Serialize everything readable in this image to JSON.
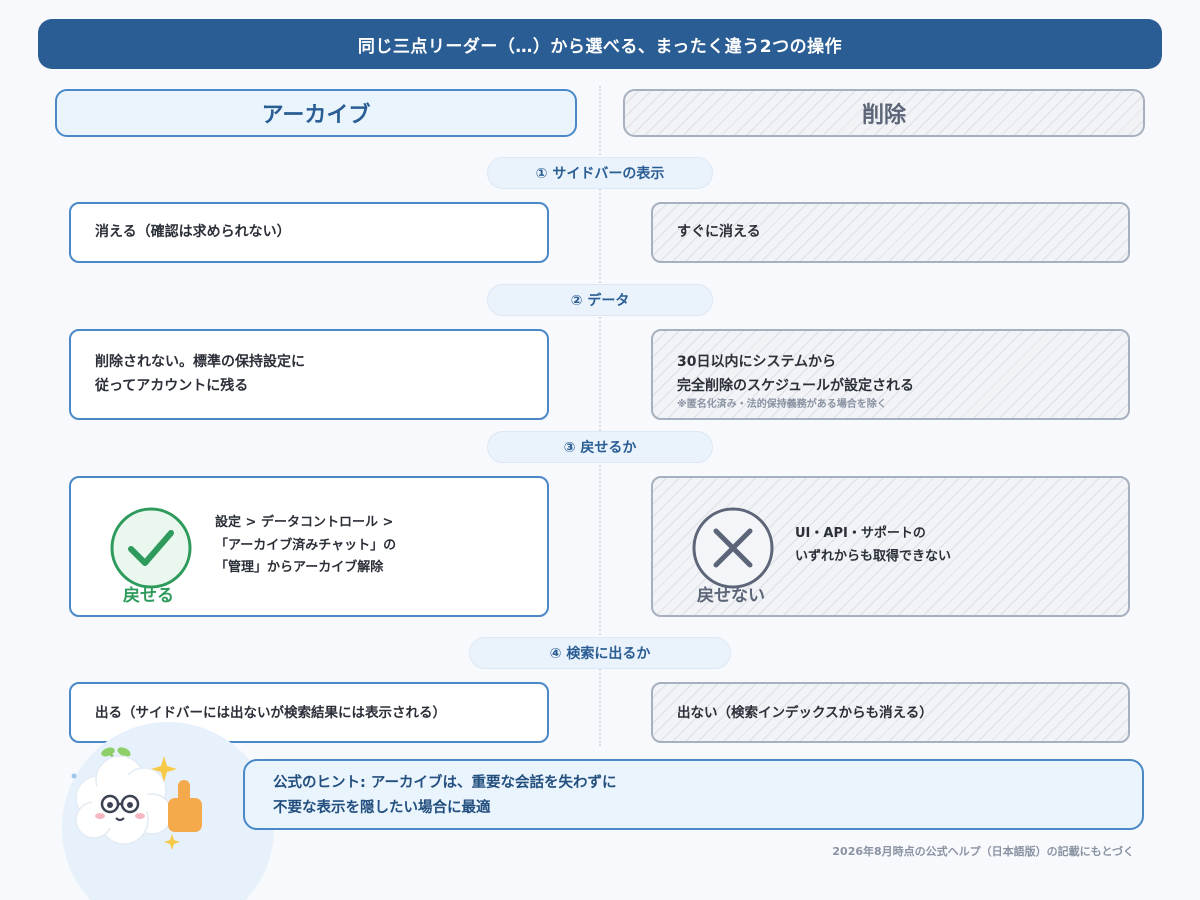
{
  "title": "同じ三点リーダー（…）から選べる、まったく違う2つの操作",
  "columns": {
    "archive": "アーカイブ",
    "delete": "削除"
  },
  "sections": [
    {
      "label": "① サイドバーの表示",
      "archive_lines": [
        "消える（確認は求められない）"
      ],
      "delete_lines": [
        "すぐに消える"
      ]
    },
    {
      "label": "② データ",
      "archive_lines": [
        "削除されない。標準の保持設定に",
        "従ってアカウントに残る"
      ],
      "delete_lines": [
        "30日以内にシステムから",
        "完全削除のスケジュールが設定される"
      ],
      "delete_note": "※匿名化済み・法的保持義務がある場合を除く"
    },
    {
      "label": "③ 戻せるか",
      "archive_badge": "戻せる",
      "archive_lines": [
        "設定 > データコントロール >",
        "「アーカイブ済みチャット」の",
        "「管理」からアーカイブ解除"
      ],
      "delete_badge": "戻せない",
      "delete_lines": [
        "UI・API・サポートの",
        "いずれからも取得できない"
      ]
    },
    {
      "label": "④ 検索に出るか",
      "archive_lines": [
        "出る（サイドバーには出ないが検索結果には表示される）"
      ],
      "delete_lines": [
        "出ない（検索インデックスからも消える）"
      ]
    }
  ],
  "tip": {
    "lines": [
      "公式のヒント: アーカイブは、重要な会話を失わずに",
      "不要な表示を隠したい場合に最適"
    ]
  },
  "footer_note": "2026年8月時点の公式ヘルプ（日本語版）の記載にもとづく",
  "colors": {
    "primary": "#2a5d93",
    "accent_border": "#4a88c7",
    "success": "#2e9a5c",
    "neutral": "#5c6678"
  },
  "icons": {
    "restorable": "check-circle-icon",
    "not_restorable": "x-circle-icon",
    "mascot": "cloud-mascot-icon",
    "thumbs_up": "thumbs-up-icon",
    "sparkle": "sparkle-icon"
  }
}
